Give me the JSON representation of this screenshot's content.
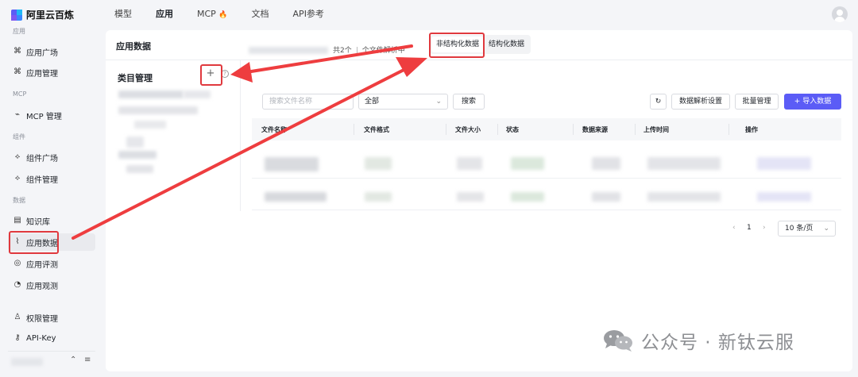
{
  "app": {
    "logo_text": "阿里云百炼"
  },
  "topnav": [
    "模型",
    "应用",
    "MCP",
    "文档",
    "API参考"
  ],
  "topnav_fire": "🔥",
  "sidebar": {
    "sections": [
      "应用",
      "MCP",
      "组件",
      "数据"
    ],
    "items": [
      {
        "label": "应用广场",
        "icon": "grid-icon"
      },
      {
        "label": "应用管理",
        "icon": "grid-icon"
      },
      {
        "label": "MCP 管理",
        "icon": "plug-icon"
      },
      {
        "label": "组件广场",
        "icon": "component-icon"
      },
      {
        "label": "组件管理",
        "icon": "component-icon"
      },
      {
        "label": "知识库",
        "icon": "book-icon"
      },
      {
        "label": "应用数据",
        "icon": "chart-icon"
      },
      {
        "label": "应用评测",
        "icon": "compass-icon"
      },
      {
        "label": "应用观测",
        "icon": "pie-icon"
      },
      {
        "label": "权限管理",
        "icon": "user-icon"
      },
      {
        "label": "API-Key",
        "icon": "key-icon"
      }
    ],
    "active": "应用数据",
    "footer_collapse": "⌃",
    "footer_menu": "≡"
  },
  "main": {
    "title": "应用数据",
    "tabs": [
      "非结构化数据",
      "结构化数据"
    ],
    "active_tab": "非结构化数据",
    "category": {
      "title": "类目管理",
      "add": "+",
      "help": "?"
    },
    "summary": {
      "count_text": "共2个",
      "parsing_text": "个文件解析中"
    },
    "search_placeholder": "搜索文件名称",
    "filter_value": "全部",
    "search_button": "搜索",
    "refresh_icon": "↻",
    "parse_settings_button": "数据解析设置",
    "batch_button": "批量管理",
    "import_button": "导入数据",
    "import_icon": "+",
    "columns": [
      "文件名称",
      "文件格式",
      "文件大小",
      "状态",
      "数据来源",
      "上传时间",
      "操作"
    ],
    "pagination": {
      "prev": "‹",
      "page": "1",
      "next": "›",
      "page_size": "10 条/页"
    }
  },
  "watermark": {
    "text": "公众号 · 新钛云服"
  },
  "colors": {
    "primary": "#5b5cf6",
    "highlight": "#e0393e",
    "arrow": "#ee3d3f"
  }
}
